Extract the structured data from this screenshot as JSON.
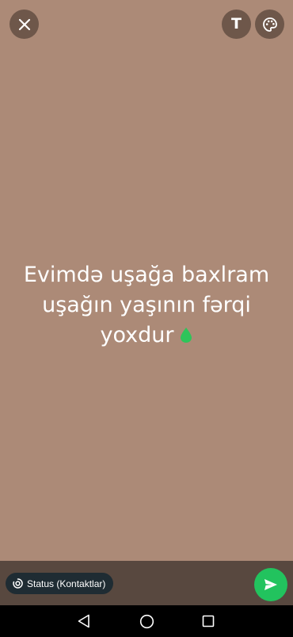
{
  "status_text": {
    "lines": [
      "Evimdə uşağa baxlram",
      "uşağın yaşının fərqi",
      "yoxdur"
    ]
  },
  "background_color": "#ac8a77",
  "toolbar": {
    "close_icon": "close-icon",
    "text_tool_label": "T",
    "palette_icon": "palette-icon"
  },
  "bottom_bar": {
    "audience_label": "Status (Kontaktlar)",
    "audience_icon": "status-ring-icon",
    "send_icon": "send-icon",
    "send_color": "#22c35e"
  },
  "nav_bar": {
    "back_icon": "back-triangle-icon",
    "home_icon": "home-circle-icon",
    "recents_icon": "recents-square-icon"
  }
}
